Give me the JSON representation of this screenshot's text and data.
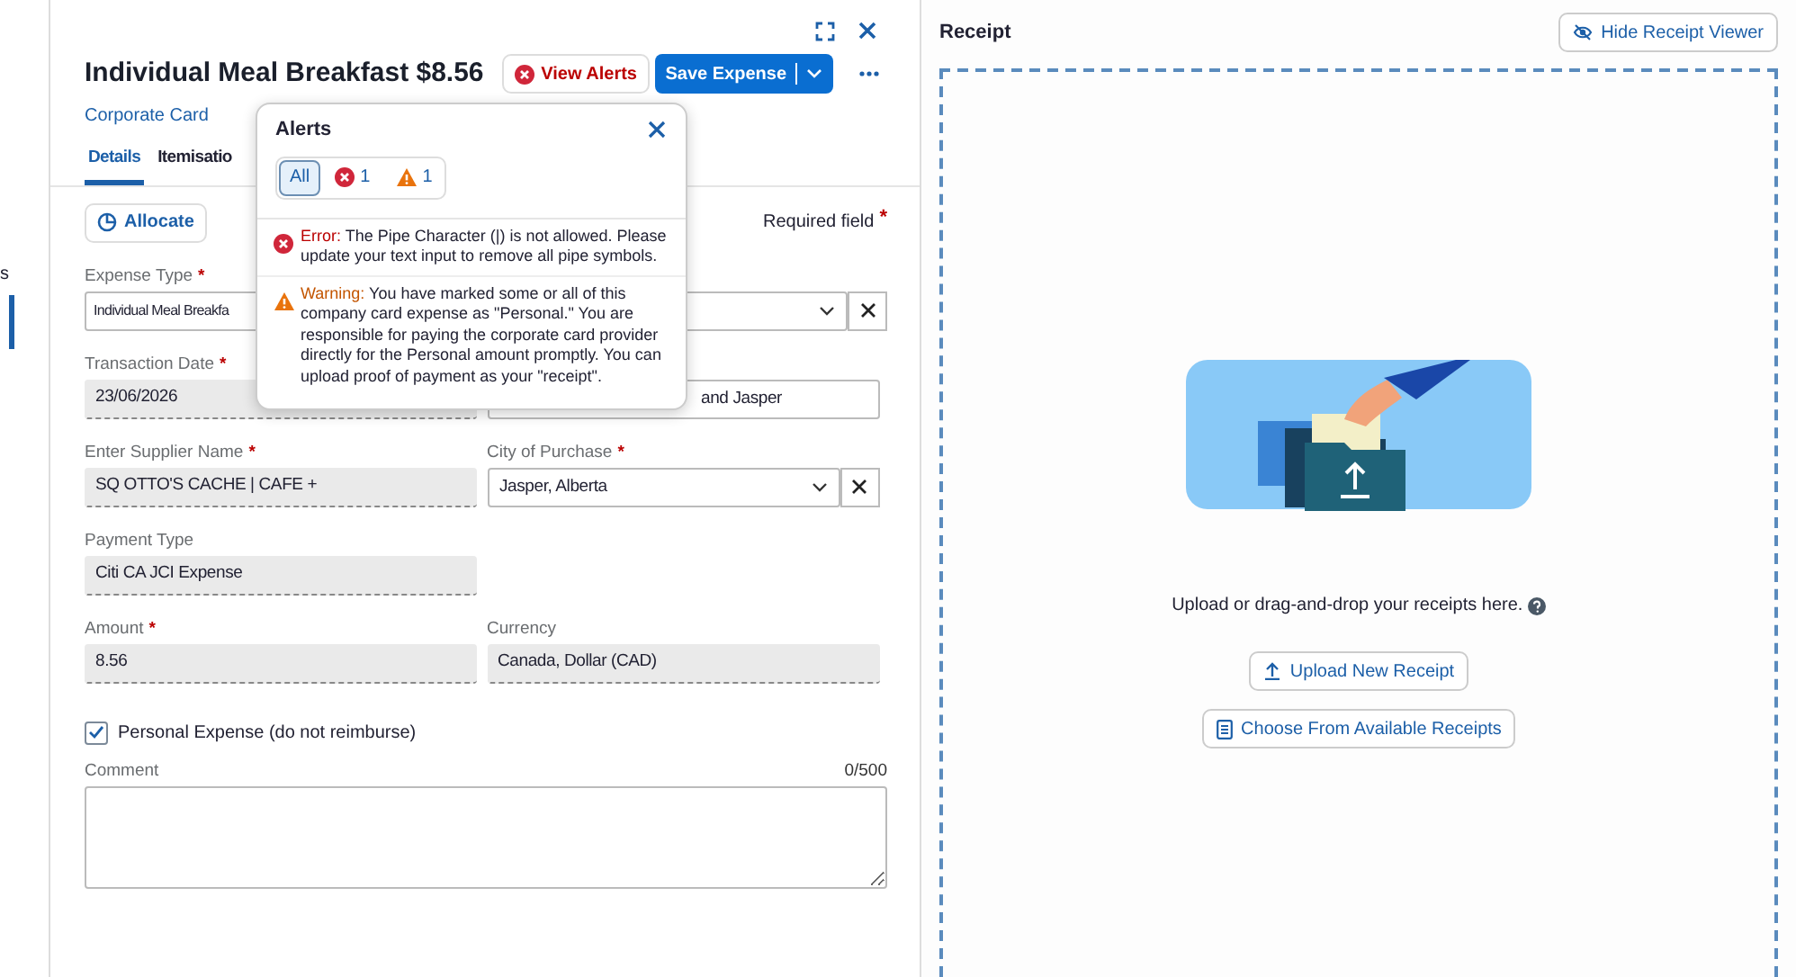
{
  "sidebar_fragment": {
    "text": "s"
  },
  "header": {
    "title": "Individual Meal Breakfast $8.56",
    "alerts_button": "View Alerts",
    "save_button": "Save Expense",
    "link": "Corporate Card"
  },
  "tabs": [
    {
      "label": "Details",
      "selected": true
    },
    {
      "label": "Itemisatio",
      "selected": false
    }
  ],
  "allocate_button": "Allocate",
  "required_note": {
    "text": "Required field",
    "mark": "*"
  },
  "rows": [
    [
      {
        "kind": "combo",
        "label": "Expense Type",
        "mark": "*",
        "value": "Individual Meal Breakfa"
      }
    ],
    [
      {
        "kind": "readonly",
        "label": "Transaction Date",
        "mark": "*",
        "value": "23/06/2026"
      },
      {
        "kind": "text",
        "value": "and Jasper"
      }
    ],
    [
      {
        "kind": "readonly",
        "label": "Enter Supplier Name",
        "mark": "*",
        "value": "SQ  OTTO'S CACHE | CAFE +"
      },
      {
        "kind": "select",
        "label": "City of Purchase",
        "mark": "*",
        "value": "Jasper, Alberta"
      }
    ],
    [
      {
        "kind": "readonly",
        "label": "Payment Type",
        "value": "Citi CA JCI Expense"
      }
    ],
    [
      {
        "kind": "readonly",
        "label": "Amount",
        "mark": "*",
        "value": "8.56"
      },
      {
        "kind": "readonly",
        "label": "Currency",
        "value": "Canada, Dollar (CAD)"
      }
    ]
  ],
  "checkbox": {
    "label": "Personal Expense (do not reimburse)",
    "checked": true
  },
  "comment": {
    "label": "Comment",
    "counter": "0/500"
  },
  "alerts_popover": {
    "title": "Alerts",
    "filters": [
      {
        "kind": "all",
        "label": "All",
        "selected": true
      },
      {
        "kind": "error",
        "label": "1",
        "selected": false
      },
      {
        "kind": "warning",
        "label": "1",
        "selected": false
      }
    ],
    "messages": [
      {
        "kind": "error",
        "prefix": "Error:",
        "text": "The Pipe Character (|) is not allowed. Please update your text input to remove all pipe symbols."
      },
      {
        "kind": "warning",
        "prefix": "Warning:",
        "text": "You have marked some or all of this company card expense as \"Personal.\" You are responsible for paying the corporate card provider directly for the Personal amount promptly. You can upload proof of payment as your \"receipt\"."
      }
    ]
  },
  "receipt": {
    "title": "Receipt",
    "hide_button": "Hide Receipt Viewer",
    "hint": "Upload or drag-and-drop your receipts here.",
    "buttons": [
      {
        "kind": "upload",
        "label": "Upload New Receipt"
      },
      {
        "kind": "choose",
        "label": "Choose From Available Receipts"
      }
    ]
  }
}
